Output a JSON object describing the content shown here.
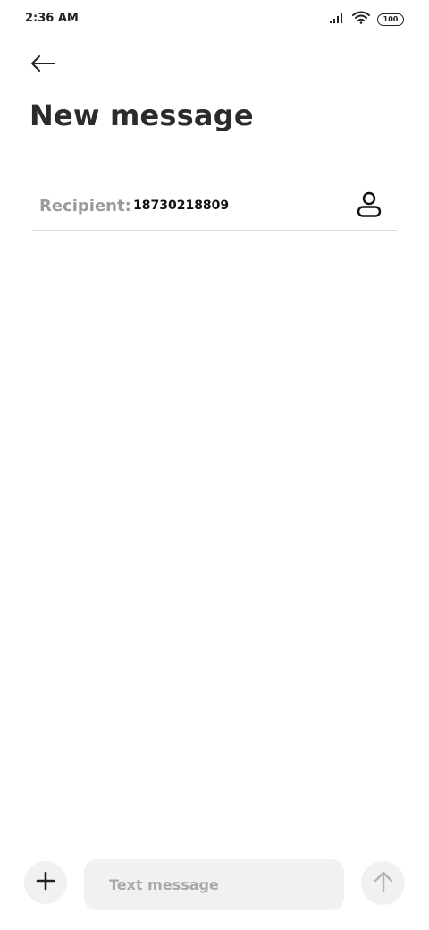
{
  "status_bar": {
    "time": "2:36 AM",
    "battery_level": "100",
    "icons": [
      "signal-icon",
      "wifi-icon",
      "battery-icon"
    ]
  },
  "header": {
    "back_icon": "arrow-left-icon",
    "title": "New message"
  },
  "recipient": {
    "label": "Recipient:",
    "value": "18730218809",
    "contact_icon": "person-icon"
  },
  "composer": {
    "attach_icon": "plus-icon",
    "placeholder": "Text message",
    "send_icon": "arrow-up-icon"
  }
}
